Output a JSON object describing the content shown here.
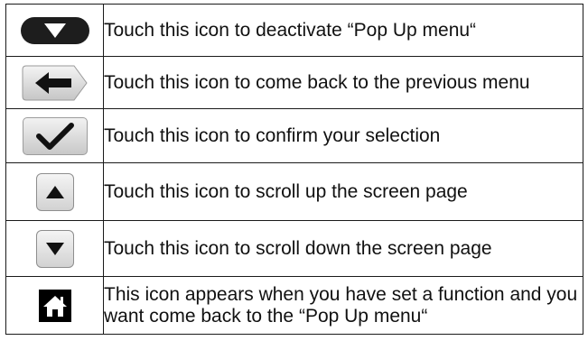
{
  "rows": [
    {
      "icon": "deactivate-popup-icon",
      "text": "Touch this icon to deactivate “Pop Up menu“"
    },
    {
      "icon": "back-arrow-icon",
      "text": "Touch this icon to come back to the previous menu"
    },
    {
      "icon": "checkmark-icon",
      "text": "Touch this icon to confirm your selection"
    },
    {
      "icon": "scroll-up-icon",
      "text": "Touch this icon to scroll up the screen page"
    },
    {
      "icon": "scroll-down-icon",
      "text": "Touch this icon to scroll down the screen page"
    },
    {
      "icon": "home-icon",
      "text": "This icon appears when you have set a function and you want come back to the “Pop Up menu“"
    }
  ],
  "colors": {
    "icon_dark": "#1d1d1d",
    "button_grey_top": "#f2f2f2",
    "button_grey_bottom": "#c8c8c8",
    "border": "#1a1a1a",
    "text": "#111111"
  }
}
